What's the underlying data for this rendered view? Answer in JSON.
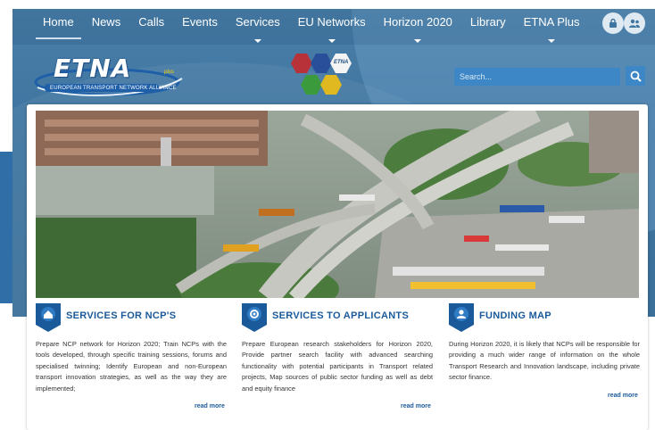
{
  "nav": {
    "items": [
      {
        "label": "Home",
        "active": true,
        "dropdown": false
      },
      {
        "label": "News",
        "active": false,
        "dropdown": false
      },
      {
        "label": "Calls",
        "active": false,
        "dropdown": false
      },
      {
        "label": "Events",
        "active": false,
        "dropdown": false
      },
      {
        "label": "Services",
        "active": false,
        "dropdown": true
      },
      {
        "label": "EU Networks",
        "active": false,
        "dropdown": true
      },
      {
        "label": "Horizon 2020",
        "active": false,
        "dropdown": true
      },
      {
        "label": "Library",
        "active": false,
        "dropdown": false
      },
      {
        "label": "ETNA Plus",
        "active": false,
        "dropdown": true
      }
    ],
    "right_icons": [
      "lock-icon",
      "users-icon"
    ]
  },
  "logo": {
    "text": "ETNA",
    "subtitle": "EUROPEAN TRANSPORT NETWORK ALLIANCE",
    "badge": "plus"
  },
  "emblem": {
    "label": "ETNA"
  },
  "search": {
    "placeholder": "Search..."
  },
  "colors": {
    "header": "#3f75a0",
    "accent": "#1a5a9a",
    "search": "#3d87c6"
  },
  "columns": [
    {
      "icon": "home-icon",
      "title": "SERVICES FOR NCP'S",
      "text": "Prepare NCP network for Horizon 2020; Train NCPs with the tools developed, through specific training sessions, forums and specialised twinning; Identify European and non-European transport innovation strategies, as well as the way they are implemented;",
      "link": "read more"
    },
    {
      "icon": "gear-icon",
      "title": "SERVICES TO APPLICANTS",
      "text": "Prepare European research stakeholders for Horizon 2020, Provide partner search facility with advanced searching functionality with potential participants in Transport related projects, Map sources of public sector funding as well as debt and equity finance",
      "link": "read more"
    },
    {
      "icon": "user-icon",
      "title": "FUNDING MAP",
      "text": "During Horizon 2020, it is likely that NCPs will be responsible for providing a much wider range of information on the whole Transport Research and Innovation landscape, including private sector finance.",
      "link": "read more"
    }
  ]
}
